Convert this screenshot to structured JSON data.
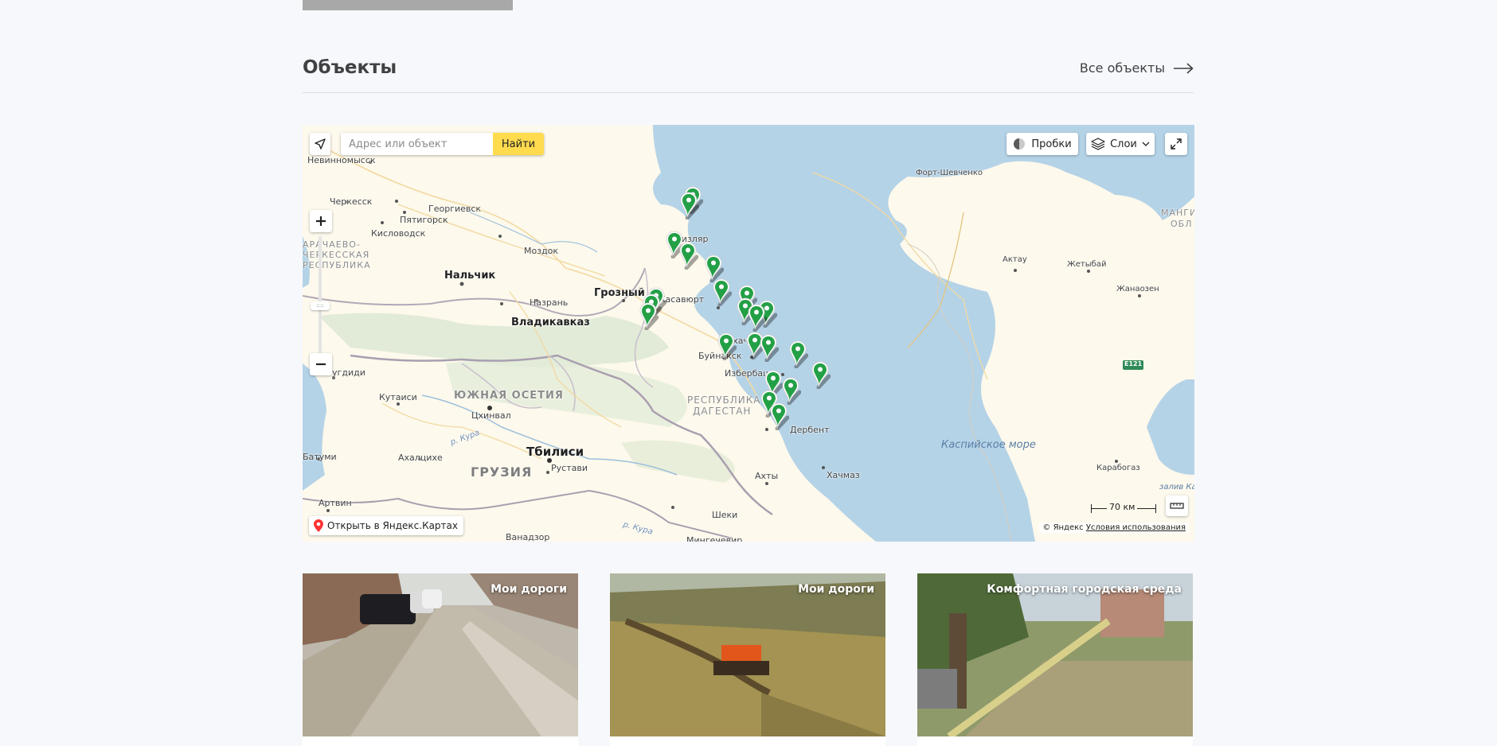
{
  "section": {
    "title": "Объекты",
    "all_link": "Все объекты"
  },
  "map": {
    "search_placeholder": "Адрес или объект",
    "search_button": "Найти",
    "traffic_button": "Пробки",
    "layers_button": "Слои",
    "open_in_yandex": "Открыть в Яндекс.Картах",
    "copyright": "© Яндекс",
    "terms_link": "Условия использования",
    "scale_label": "70 км",
    "labels": {
      "nevinnomyssk": "Невинномысск",
      "cherkessk": "Черкесск",
      "georgievsk": "Георгиевск",
      "pyatigorsk": "Пятигорск",
      "kislovodsk": "Кисловодск",
      "kchr": "ЧЕРКЕССКАЯ",
      "kchr2": "РЕСПУБЛИКА",
      "kchr0": "АРАЧАЕВО-",
      "mozdok": "Моздок",
      "nalchik": "Нальчик",
      "grozny": "Грозный",
      "nazran": "Назрань",
      "vladikavkaz": "Владикавказ",
      "khasavyurt": "Хасавюрт",
      "kizlyar": "Кизляр",
      "makhachkala": "Махачкала",
      "buynaksk": "Буйнакск",
      "izberbash": "Избербаш",
      "dagestan1": "РЕСПУБЛИКА",
      "dagestan2": "ДАГЕСТАН",
      "derbent": "Дербент",
      "akhty": "Ахты",
      "khachmaz": "Хачмаз",
      "sheki": "Шеки",
      "mingachevir": "Мингечевир",
      "zugdidi": "Зугдиди",
      "kutaisi": "Кутаиси",
      "south_ossetia": "ЮЖНАЯ ОСЕТИЯ",
      "tskhinval": "Цхинвал",
      "georgia": "ГРУЗИЯ",
      "tbilisi": "Тбилиси",
      "rustavi": "Рустави",
      "batumi": "Батуми",
      "akhaltsikhe": "Ахалцихе",
      "artvin": "Артвин",
      "vanadzor": "Ванадзор",
      "kura1": "р. Кура",
      "kura2": "р. Кура",
      "caspian": "Каспийское море",
      "fort_shevchenko": "Форт-Шевченко",
      "aktau": "Актау",
      "zhetybai": "Жетыбай",
      "zhanaozen": "Жанаозен",
      "mangi": "МАНГИ",
      "mangi2": "ОБЛ",
      "karabogaz": "Карабогаз",
      "gulf": "залив Ка",
      "e121": "E121"
    }
  },
  "cards": [
    {
      "tag": "Мои дороги"
    },
    {
      "tag": "Мои дороги"
    },
    {
      "tag": "Комфортная городская среда"
    }
  ],
  "colors": {
    "marker": "#23a046",
    "search_button": "#ffdb4d",
    "sea": "#b5d3e7"
  }
}
